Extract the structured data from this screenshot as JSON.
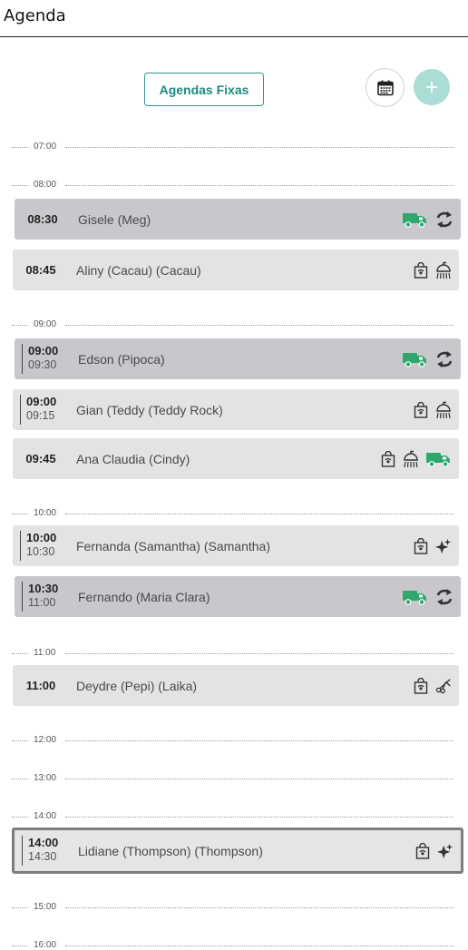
{
  "header": {
    "title": "Agenda"
  },
  "toolbar": {
    "fixed_label": "Agendas Fixas",
    "add_label": "+"
  },
  "colors": {
    "accent": "#2a9a8f",
    "add_bg": "#a9ddd5",
    "truck": "#2fa86e",
    "card": "#e3e3e3",
    "card_fixed": "#c8c8cc"
  },
  "hours": {
    "h07": "07:00",
    "h08": "08:00",
    "h09": "09:00",
    "h10": "10:00",
    "h11": "11:00",
    "h12": "12:00",
    "h13": "13:00",
    "h14": "14:00",
    "h15": "15:00",
    "h16": "16:00"
  },
  "appointments": [
    {
      "time": "08:30",
      "name": "Gisele (Meg)",
      "icons": [
        "truck-icon",
        "repeat-icon"
      ]
    },
    {
      "time": "08:45",
      "name": "Aliny (Cacau)  (Cacau)",
      "icons": [
        "pet-bag-icon",
        "shower-icon"
      ]
    },
    {
      "start": "09:00",
      "end": "09:30",
      "name": "Edson (Pipoca)",
      "icons": [
        "truck-icon",
        "repeat-icon"
      ]
    },
    {
      "start": "09:00",
      "end": "09:15",
      "name": "Gian (Teddy  (Teddy Rock)",
      "icons": [
        "pet-bag-icon",
        "shower-icon"
      ]
    },
    {
      "time": "09:45",
      "name": "Ana Claudia  (Cindy)",
      "icons": [
        "pet-bag-icon",
        "shower-icon",
        "truck-icon"
      ]
    },
    {
      "start": "10:00",
      "end": "10:30",
      "name": "Fernanda (Samantha)  (Samantha)",
      "icons": [
        "pet-bag-icon",
        "sparkle-icon"
      ]
    },
    {
      "start": "10:30",
      "end": "11:00",
      "name": "Fernando (Maria Clara)",
      "icons": [
        "truck-icon",
        "repeat-icon"
      ]
    },
    {
      "time": "11:00",
      "name": "Deydre (Pepi)  (Laika)",
      "icons": [
        "pet-bag-icon",
        "scissors-icon"
      ]
    },
    {
      "start": "14:00",
      "end": "14:30",
      "name": "Lidiane (Thompson)  (Thompson)",
      "icons": [
        "pet-bag-icon",
        "sparkle-icon"
      ]
    }
  ]
}
